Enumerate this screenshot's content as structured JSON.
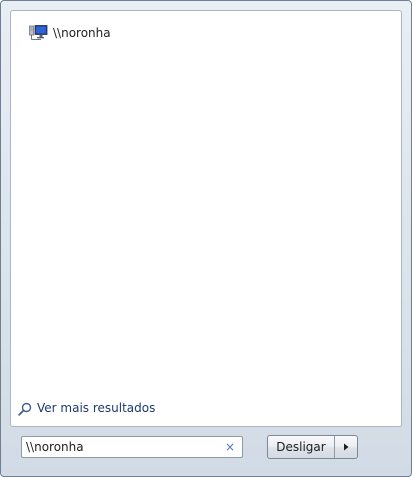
{
  "results": {
    "items": [
      {
        "label": "\\\\noronha",
        "icon": "network-computer-icon"
      }
    ]
  },
  "more_results": {
    "label": "Ver mais resultados",
    "icon": "search-icon"
  },
  "search": {
    "value": "\\\\noronha",
    "clear_icon": "×"
  },
  "shutdown": {
    "label": "Desligar",
    "arrow_icon": "triangle-right-icon"
  },
  "colors": {
    "link": "#1c3a6e",
    "clear": "#4d78b8",
    "frame": "#dce4ec"
  }
}
